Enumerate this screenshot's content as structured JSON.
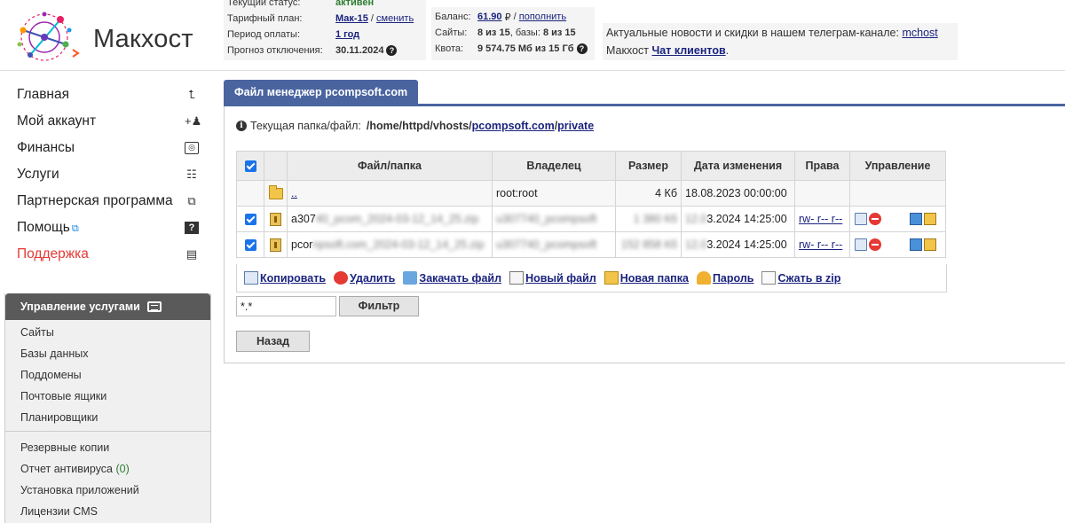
{
  "brand": {
    "name": "Макхост"
  },
  "status": {
    "status_label": "Текущий статус:",
    "status_value": "активен",
    "plan_label": "Тарифный план:",
    "plan_value": "Мак-15",
    "plan_change": "сменить",
    "period_label": "Период оплаты:",
    "period_value": "1 год",
    "forecast_label": "Прогноз отключения:",
    "forecast_value": "30.11.2024"
  },
  "balance": {
    "balance_label": "Баланс:",
    "balance_value": "61.90",
    "currency": "₽",
    "topup": "пополнить",
    "sites_label": "Сайты:",
    "sites_value": "8 из 15",
    "db_label": "базы:",
    "db_value": "8 из 15",
    "quota_label": "Квота:",
    "quota_value": "9 574.75 Мб из 15 Гб"
  },
  "news": {
    "line1": "Актуальные новости и скидки в нашем телеграм-канале:",
    "line1_link": "mchost",
    "line2": "Макхост",
    "line2_link": "Чат клиентов",
    "line2_end": "."
  },
  "sidebar": {
    "items": [
      {
        "label": "Главная",
        "icon": "home-arrow-icon"
      },
      {
        "label": "Мой аккаунт",
        "icon": "user-plus-icon"
      },
      {
        "label": "Финансы",
        "icon": "money-icon"
      },
      {
        "label": "Услуги",
        "icon": "list-icon"
      },
      {
        "label": "Партнерская программа",
        "icon": "partner-icon"
      },
      {
        "label": "Помощь",
        "icon": "help-icon"
      },
      {
        "label": "Поддержка",
        "icon": "support-icon"
      }
    ]
  },
  "services": {
    "title": "Управление услугами",
    "group1": [
      "Сайты",
      "Базы данных",
      "Поддомены",
      "Почтовые ящики",
      "Планировщики"
    ],
    "group2": [
      "Резервные копии",
      "Отчет антивируса",
      "Установка приложений",
      "Лицензии CMS"
    ],
    "antivirus_count": "(0)"
  },
  "filemanager": {
    "tab": "Файл менеджер pcompsoft.com",
    "path_label": "Текущая папка/файл:",
    "path_prefix": "/home/httpd/vhosts/",
    "path_link1": "pcompsoft.com",
    "path_sep": "/",
    "path_link2": "private",
    "columns": [
      "Файл/папка",
      "Владелец",
      "Размер",
      "Дата изменения",
      "Права",
      "Управление"
    ],
    "parent_row": {
      "name": "..",
      "owner": "root:root",
      "size": "4 Кб",
      "date": "18.08.2023 00:00:00"
    },
    "rows": [
      {
        "name_visible": "a307",
        "name_blurred": "40_pcom_2024-03-12_14_25.zip",
        "owner_blurred": "u307740_pcompsoft",
        "size_blurred": "1 380 Кб",
        "date_blurred": "12.0",
        "date_visible": "3.2024 14:25:00",
        "perms": "rw- r-- r--"
      },
      {
        "name_visible": "pcor",
        "name_blurred": "npsoft.com_2024-03-12_14_25.zip",
        "owner_blurred": "u307740_pcompsoft",
        "size_blurred": "152 858 Кб",
        "date_blurred": "12.0",
        "date_visible": "3.2024 14:25:00",
        "perms": "rw- r-- r--"
      }
    ],
    "actions": [
      "Копировать",
      "Удалить",
      "Закачать файл",
      "Новый файл",
      "Новая папка",
      "Пароль",
      "Сжать в zip"
    ],
    "filter_value": "*.*",
    "filter_button": "Фильтр",
    "back_button": "Назад"
  }
}
